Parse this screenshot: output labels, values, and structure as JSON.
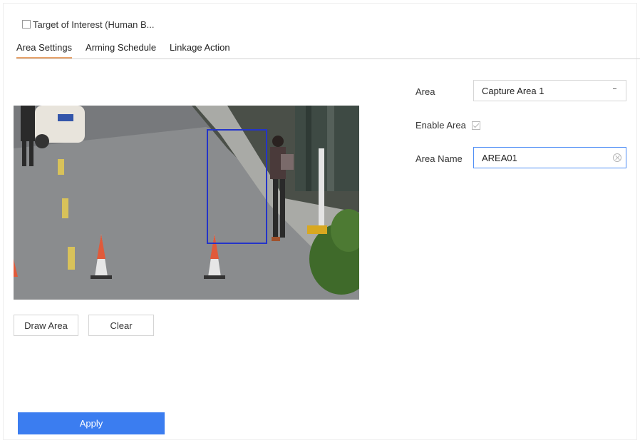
{
  "target_of_interest": {
    "label": "Target of Interest (Human B...",
    "checked": false
  },
  "tabs": [
    {
      "label": "Area Settings",
      "active": true
    },
    {
      "label": "Arming Schedule",
      "active": false
    },
    {
      "label": "Linkage Action",
      "active": false
    }
  ],
  "video": {
    "detection_box_color": "#2434c8"
  },
  "buttons": {
    "draw_area": "Draw Area",
    "clear": "Clear",
    "apply": "Apply"
  },
  "form": {
    "area_label": "Area",
    "area_value": "Capture Area 1",
    "enable_area_label": "Enable Area",
    "enable_area_checked": true,
    "area_name_label": "Area Name",
    "area_name_value": "AREA01"
  },
  "colors": {
    "accent": "#3b7df0",
    "active_tab_underline": "#e8a36b"
  }
}
